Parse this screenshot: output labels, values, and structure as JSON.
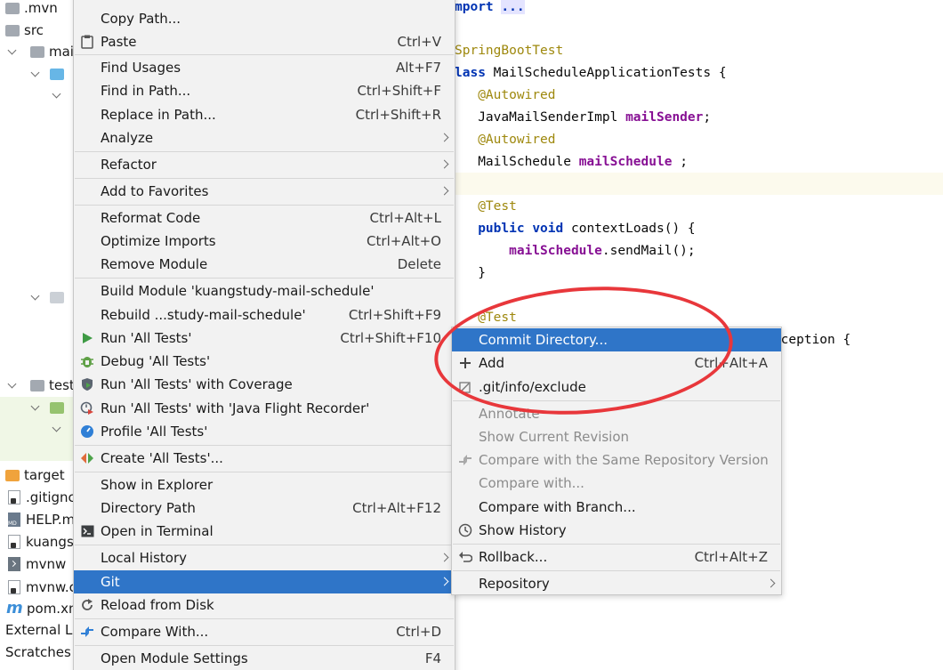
{
  "project_tree": {
    "items": [
      ".mvn",
      "src",
      "mai",
      "test",
      "target",
      ".gitignc",
      "HELP.m",
      "kuangs",
      "mvnw",
      "mvnw.c",
      "pom.xn",
      "External Lil",
      "Scratches a"
    ]
  },
  "editor": {
    "lines": {
      "import_kw": "mport",
      "import_fold": "...",
      "springboot_ann": "SpringBootTest",
      "class_kw": "lass",
      "class_rest": " MailScheduleApplicationTests {",
      "autowired1": "@Autowired",
      "mailsender_type": "JavaMailSenderImpl ",
      "mailsender_name": "mailSender",
      "semicolon": ";",
      "autowired2": "@Autowired",
      "schedule_type": "MailSchedule ",
      "schedule_name": "mailSchedule",
      "schedule_end": " ;",
      "test1": "@Test",
      "public_kw": "public",
      "void_kw": "void",
      "method_rest": " contextLoads() {",
      "call_obj": "mailSchedule",
      "call_rest": ".sendMail();",
      "close_brace": "}",
      "test2": "@Test",
      "exception_tail": "sagingException {"
    }
  },
  "context_menu": {
    "items": {
      "copy_path": "Copy Path...",
      "paste": "Paste",
      "paste_sc": "Ctrl+V",
      "find_usages": "Find Usages",
      "find_usages_sc": "Alt+F7",
      "find_in_path": "Find in Path...",
      "find_in_path_sc": "Ctrl+Shift+F",
      "replace_in_path": "Replace in Path...",
      "replace_in_path_sc": "Ctrl+Shift+R",
      "analyze": "Analyze",
      "refactor": "Refactor",
      "add_to_favorites": "Add to Favorites",
      "reformat_code": "Reformat Code",
      "reformat_code_sc": "Ctrl+Alt+L",
      "optimize_imports": "Optimize Imports",
      "optimize_imports_sc": "Ctrl+Alt+O",
      "remove_module": "Remove Module",
      "remove_module_sc": "Delete",
      "build_module": "Build Module 'kuangstudy-mail-schedule'",
      "rebuild": "Rebuild ...study-mail-schedule'",
      "rebuild_sc": "Ctrl+Shift+F9",
      "run_all": "Run 'All Tests'",
      "run_all_sc": "Ctrl+Shift+F10",
      "debug_all": "Debug 'All Tests'",
      "run_coverage": "Run 'All Tests' with Coverage",
      "run_jfr": "Run 'All Tests' with 'Java Flight Recorder'",
      "profile_all": "Profile 'All Tests'",
      "create_all": "Create 'All Tests'...",
      "show_in_explorer": "Show in Explorer",
      "directory_path": "Directory Path",
      "directory_path_sc": "Ctrl+Alt+F12",
      "open_in_terminal": "Open in Terminal",
      "local_history": "Local History",
      "git": "Git",
      "reload_from_disk": "Reload from Disk",
      "compare_with": "Compare With...",
      "compare_with_sc": "Ctrl+D",
      "open_module_settings": "Open Module Settings",
      "open_module_settings_sc": "F4"
    }
  },
  "git_submenu": {
    "items": {
      "commit_directory": "Commit Directory...",
      "add": "Add",
      "add_sc": "Ctrl+Alt+A",
      "git_exclude": ".git/info/exclude",
      "annotate": "Annotate",
      "show_current_revision": "Show Current Revision",
      "compare_same_repo": "Compare with the Same Repository Version",
      "compare_with": "Compare with...",
      "compare_with_branch": "Compare with Branch...",
      "show_history": "Show History",
      "rollback": "Rollback...",
      "rollback_sc": "Ctrl+Alt+Z",
      "repository": "Repository"
    }
  },
  "colors": {
    "selection": "#2f75c8",
    "annotation_circle": "#e8373b",
    "keyword": "#0033b3",
    "annotation": "#9e880d",
    "field": "#871094"
  }
}
